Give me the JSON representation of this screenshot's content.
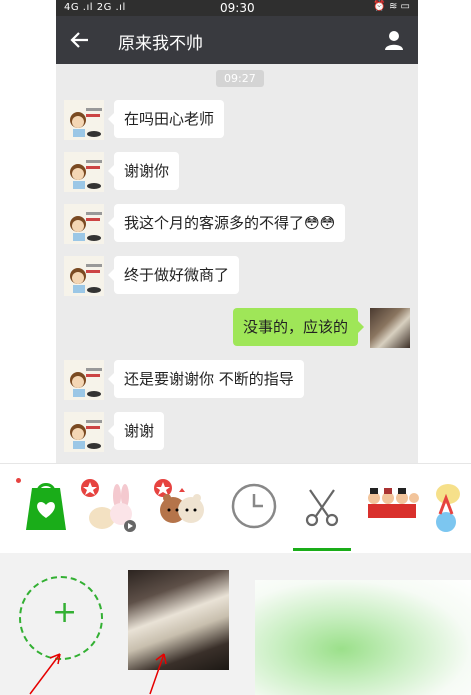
{
  "status_bar": {
    "left": "4G .ıl 2G .ıl",
    "time": "09:30",
    "right": "⏰ ≋ ▭"
  },
  "header": {
    "title": "原来我不帅"
  },
  "timestamp": "09:27",
  "messages": [
    {
      "sender": "other",
      "text": "在吗田心老师"
    },
    {
      "sender": "other",
      "text": "谢谢你"
    },
    {
      "sender": "other",
      "text": "我这个月的客源多的不得了"
    },
    {
      "sender": "other",
      "text": "终于做好微商了"
    },
    {
      "sender": "me",
      "text": "没事的，应该的"
    },
    {
      "sender": "other",
      "text": "还是要谢谢你 不断的指导"
    },
    {
      "sender": "other",
      "text": "谢谢"
    }
  ],
  "sticker_tabs": [
    {
      "icon": "shopping-bag-icon"
    },
    {
      "icon": "bunny-sticker-icon"
    },
    {
      "icon": "bears-sticker-icon"
    },
    {
      "icon": "clock-icon"
    },
    {
      "icon": "scissors-icon"
    },
    {
      "icon": "banner-sticker-icon"
    },
    {
      "icon": "balloon-sticker-icon"
    }
  ],
  "colors": {
    "wechat_green": "#1aad19",
    "my_bubble": "#9fe658",
    "title_bar": "#393a3f",
    "arrow_red": "#e60000"
  }
}
